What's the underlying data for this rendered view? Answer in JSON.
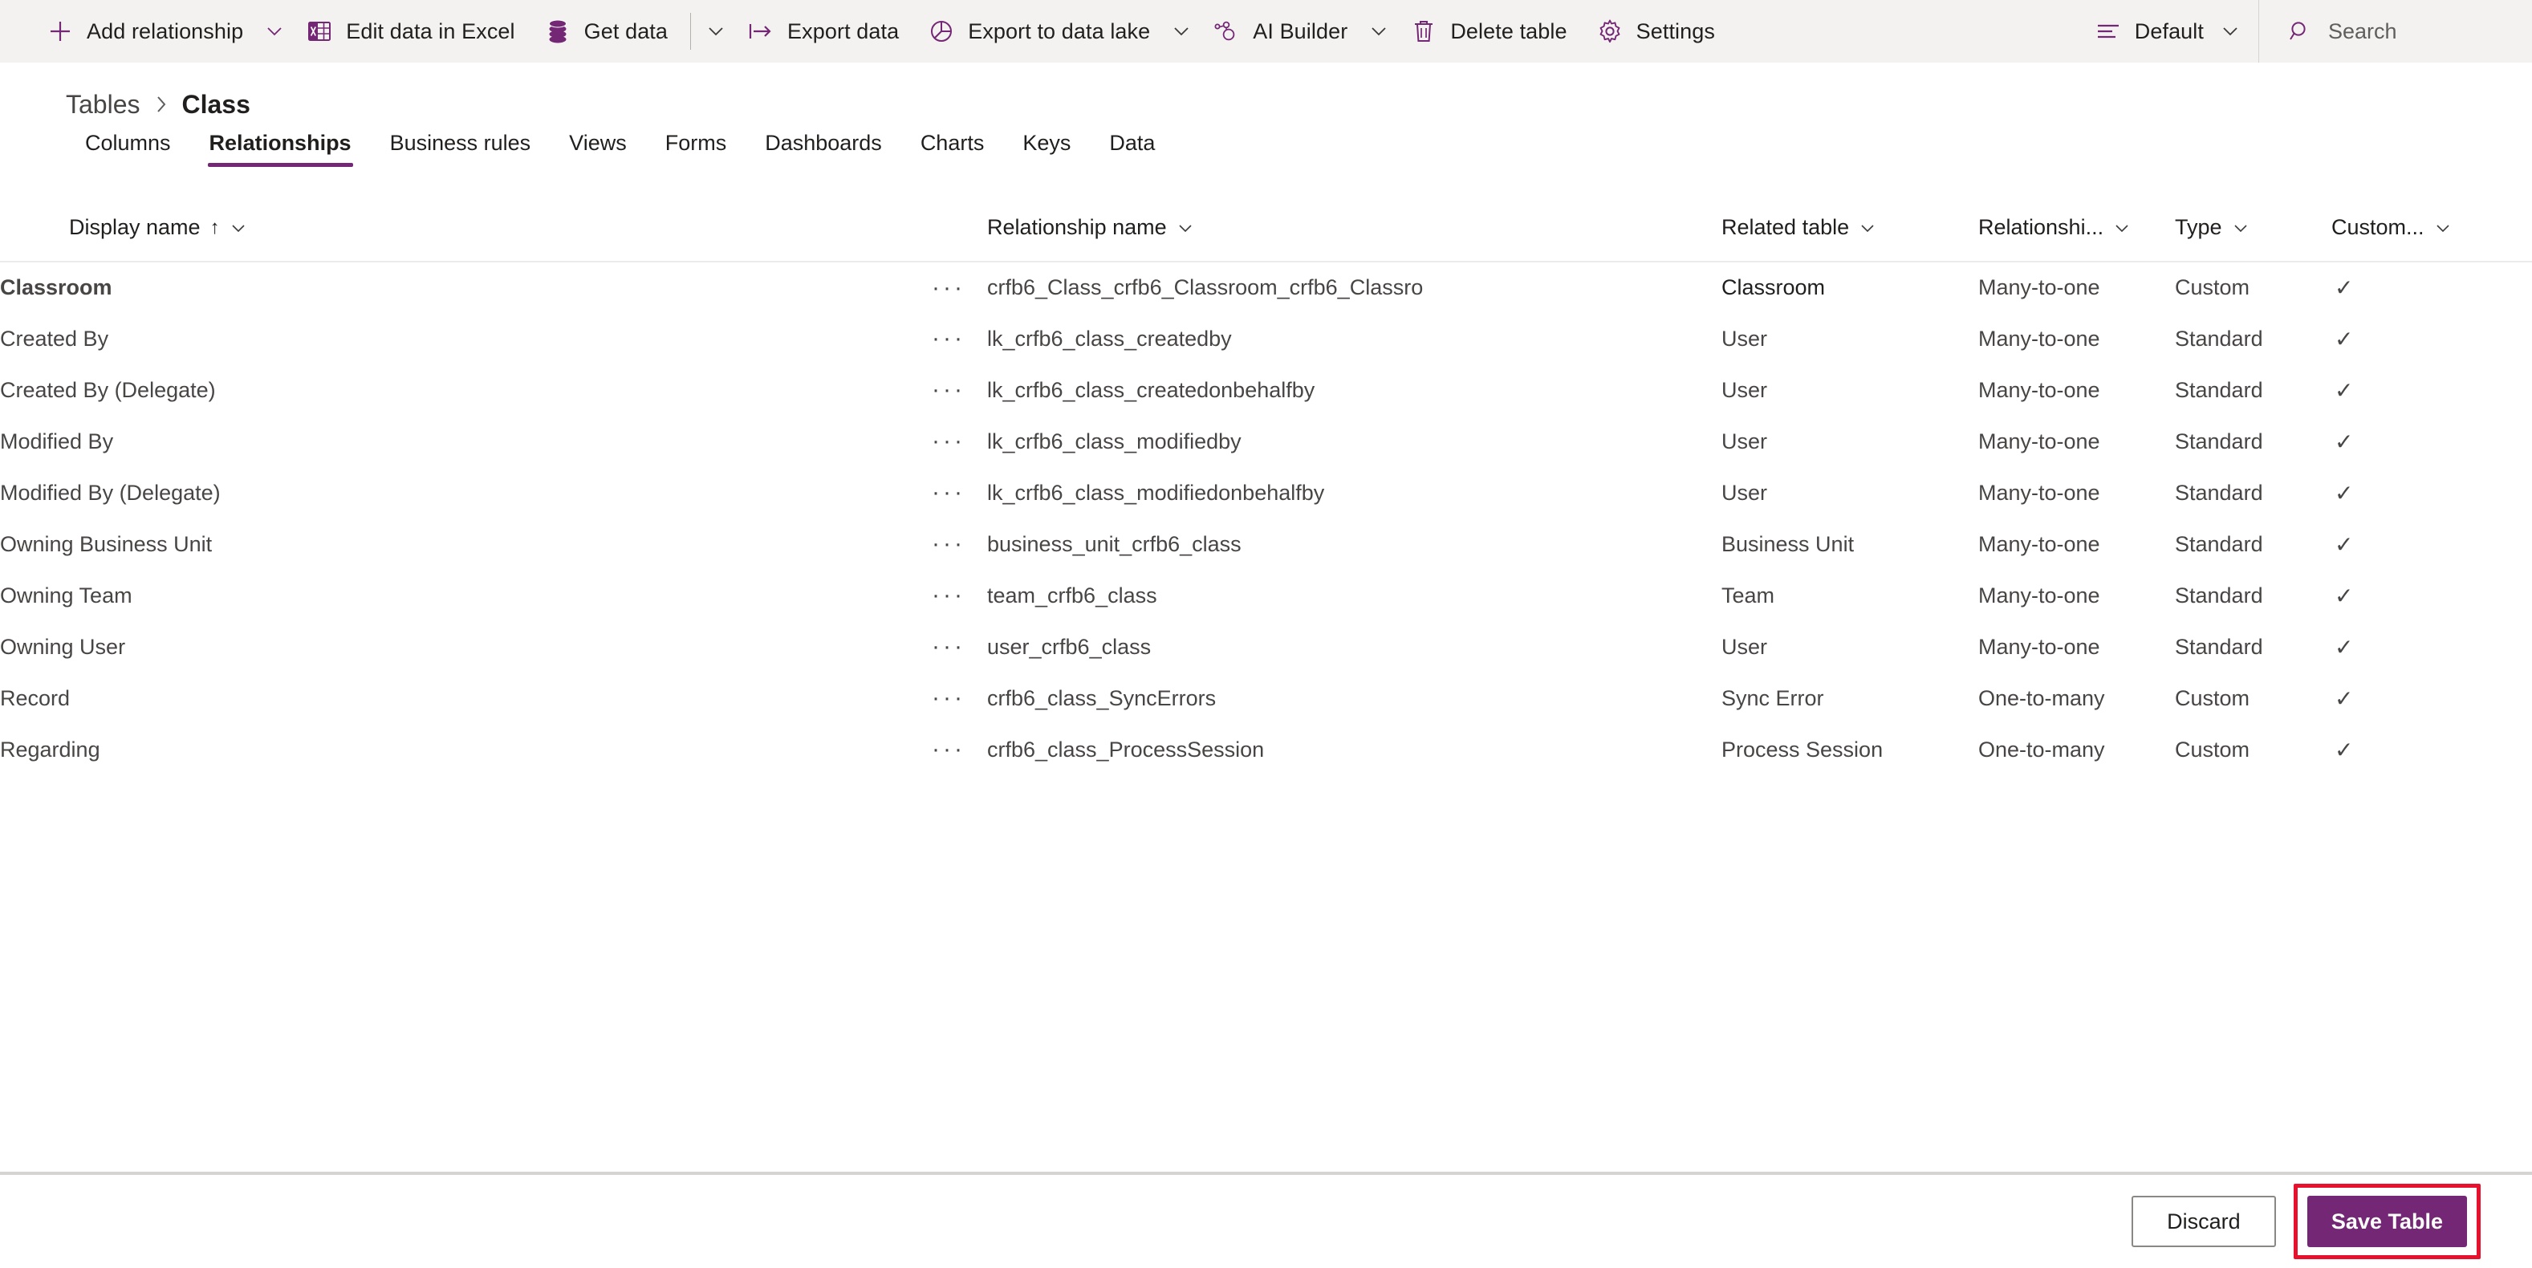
{
  "commandbar": {
    "items": [
      {
        "id": "add-relationship",
        "label": "Add relationship",
        "icon": "plus-icon",
        "caret": true
      },
      {
        "id": "edit-data-in-excel",
        "label": "Edit data in Excel",
        "icon": "excel-icon",
        "caret": false
      },
      {
        "id": "get-data",
        "label": "Get data",
        "icon": "database-icon",
        "caret": true,
        "separator_before_caret": true
      },
      {
        "id": "export-data",
        "label": "Export data",
        "icon": "export-icon",
        "caret": false
      },
      {
        "id": "export-to-data-lake",
        "label": "Export to data lake",
        "icon": "data-lake-icon",
        "caret": true
      },
      {
        "id": "ai-builder",
        "label": "AI Builder",
        "icon": "ai-builder-icon",
        "caret": true
      },
      {
        "id": "delete-table",
        "label": "Delete table",
        "icon": "trash-icon",
        "caret": false
      },
      {
        "id": "settings",
        "label": "Settings",
        "icon": "gear-icon",
        "caret": false
      }
    ],
    "view_selector": {
      "label": "Default",
      "icon": "list-view-icon",
      "caret": true
    },
    "search": {
      "placeholder": "Search",
      "icon": "search-icon"
    }
  },
  "breadcrumb": {
    "root": "Tables",
    "separator": "›",
    "current": "Class"
  },
  "tabs": [
    {
      "label": "Columns",
      "active": false
    },
    {
      "label": "Relationships",
      "active": true
    },
    {
      "label": "Business rules",
      "active": false
    },
    {
      "label": "Views",
      "active": false
    },
    {
      "label": "Forms",
      "active": false
    },
    {
      "label": "Dashboards",
      "active": false
    },
    {
      "label": "Charts",
      "active": false
    },
    {
      "label": "Keys",
      "active": false
    },
    {
      "label": "Data",
      "active": false
    }
  ],
  "grid": {
    "columns": [
      {
        "key": "display_name",
        "label": "Display name",
        "sorted": true,
        "sort_arrow": "↑",
        "caret": true
      },
      {
        "key": "row_actions",
        "label": "",
        "caret": false
      },
      {
        "key": "relationship_name",
        "label": "Relationship name",
        "caret": true
      },
      {
        "key": "related_table",
        "label": "Related table",
        "caret": true
      },
      {
        "key": "relationship_type",
        "label": "Relationshi...",
        "caret": true
      },
      {
        "key": "type",
        "label": "Type",
        "caret": true
      },
      {
        "key": "customizable",
        "label": "Custom...",
        "caret": true
      }
    ],
    "row_menu_glyph": "···",
    "check_glyph": "✓",
    "rows": [
      {
        "display_name": "Classroom",
        "relationship_name": "crfb6_Class_crfb6_Classroom_crfb6_Classro",
        "related_table": "Classroom",
        "relationship_type": "Many-to-one",
        "type": "Custom",
        "customizable": true,
        "selected": true
      },
      {
        "display_name": "Created By",
        "relationship_name": "lk_crfb6_class_createdby",
        "related_table": "User",
        "relationship_type": "Many-to-one",
        "type": "Standard",
        "customizable": true,
        "selected": false
      },
      {
        "display_name": "Created By (Delegate)",
        "relationship_name": "lk_crfb6_class_createdonbehalfby",
        "related_table": "User",
        "relationship_type": "Many-to-one",
        "type": "Standard",
        "customizable": true,
        "selected": false
      },
      {
        "display_name": "Modified By",
        "relationship_name": "lk_crfb6_class_modifiedby",
        "related_table": "User",
        "relationship_type": "Many-to-one",
        "type": "Standard",
        "customizable": true,
        "selected": false
      },
      {
        "display_name": "Modified By (Delegate)",
        "relationship_name": "lk_crfb6_class_modifiedonbehalfby",
        "related_table": "User",
        "relationship_type": "Many-to-one",
        "type": "Standard",
        "customizable": true,
        "selected": false
      },
      {
        "display_name": "Owning Business Unit",
        "relationship_name": "business_unit_crfb6_class",
        "related_table": "Business Unit",
        "relationship_type": "Many-to-one",
        "type": "Standard",
        "customizable": true,
        "selected": false
      },
      {
        "display_name": "Owning Team",
        "relationship_name": "team_crfb6_class",
        "related_table": "Team",
        "relationship_type": "Many-to-one",
        "type": "Standard",
        "customizable": true,
        "selected": false
      },
      {
        "display_name": "Owning User",
        "relationship_name": "user_crfb6_class",
        "related_table": "User",
        "relationship_type": "Many-to-one",
        "type": "Standard",
        "customizable": true,
        "selected": false
      },
      {
        "display_name": "Record",
        "relationship_name": "crfb6_class_SyncErrors",
        "related_table": "Sync Error",
        "relationship_type": "One-to-many",
        "type": "Custom",
        "customizable": true,
        "selected": false
      },
      {
        "display_name": "Regarding",
        "relationship_name": "crfb6_class_ProcessSession",
        "related_table": "Process Session",
        "relationship_type": "One-to-many",
        "type": "Custom",
        "customizable": true,
        "selected": false
      }
    ]
  },
  "footer": {
    "discard_label": "Discard",
    "save_label": "Save Table",
    "save_highlighted": true
  },
  "colors": {
    "accent_purple": "#742774",
    "commandbar_bg": "#f3f2f1",
    "highlight_red": "#e8112d",
    "text_primary": "#201f1e",
    "text_secondary": "#484644"
  }
}
